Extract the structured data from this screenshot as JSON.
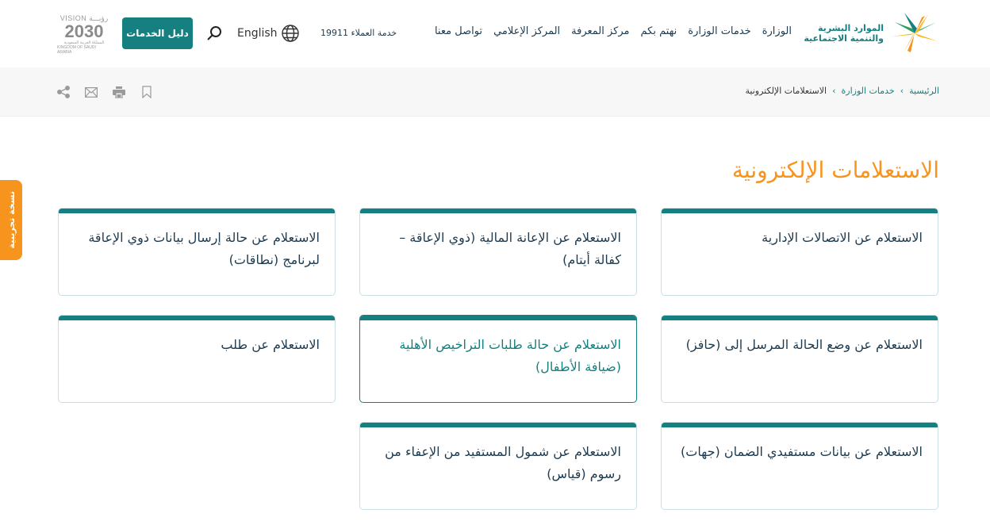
{
  "header": {
    "logo": {
      "line1": "الموارد البشرية",
      "line2": "والتنمية الاجتماعية",
      "icon": "ministry-star-logo"
    },
    "nav": [
      {
        "label": "الوزارة"
      },
      {
        "label": "خدمات الوزارة"
      },
      {
        "label": "نهتم بكم"
      },
      {
        "label": "مركز المعرفة"
      },
      {
        "label": "المركز الإعلامي"
      },
      {
        "label": "تواصل معنا"
      }
    ],
    "hotline": "خدمة العملاء 19911",
    "language": {
      "label": "English",
      "icon": "globe-icon"
    },
    "search_icon": "search-icon",
    "services_guide_label": "دليل الخدمات",
    "vision": {
      "top": "VISION رؤيـــة",
      "year": "2030",
      "bottom_ar": "المملكة العربية السعودية",
      "bottom_en": "KINGDOM OF SAUDI ARABIA"
    }
  },
  "breadcrumb": {
    "items": [
      {
        "label": "الرئيسية",
        "link": true
      },
      {
        "label": "خدمات الوزارة",
        "link": true
      },
      {
        "label": "الاستعلامات الإلكترونية",
        "link": false
      }
    ],
    "separator": "›"
  },
  "tools": [
    {
      "name": "bookmark-icon"
    },
    {
      "name": "print-icon"
    },
    {
      "name": "email-icon"
    },
    {
      "name": "share-icon"
    }
  ],
  "beta_tab": "نسخة تجريبية",
  "page_title": "الاستعلامات الإلكترونية",
  "cards": [
    {
      "title": "الاستعلام عن الاتصالات الإدارية",
      "active": false
    },
    {
      "title": "الاستعلام عن الإعانة المالية (ذوي الإعاقة – كفالة أيتام)",
      "active": false
    },
    {
      "title": "الاستعلام عن حالة إرسال بيانات ذوي الإعاقة لبرنامج (نطاقات)",
      "active": false
    },
    {
      "title": "الاستعلام عن وضع الحالة المرسل إلى (حافز)",
      "active": false
    },
    {
      "title": "الاستعلام عن حالة طلبات التراخيص الأهلية (ضيافة الأطفال)",
      "active": true
    },
    {
      "title": "الاستعلام عن طلب",
      "active": false
    },
    {
      "title": "الاستعلام عن بيانات مستفيدي الضمان (جهات)",
      "active": false
    },
    {
      "title": "الاستعلام عن شمول المستفيد من الإعفاء من رسوم (قياس)",
      "active": false
    }
  ],
  "colors": {
    "primary": "#167f80",
    "accent": "#f7941d",
    "text": "#1d3a4f"
  }
}
